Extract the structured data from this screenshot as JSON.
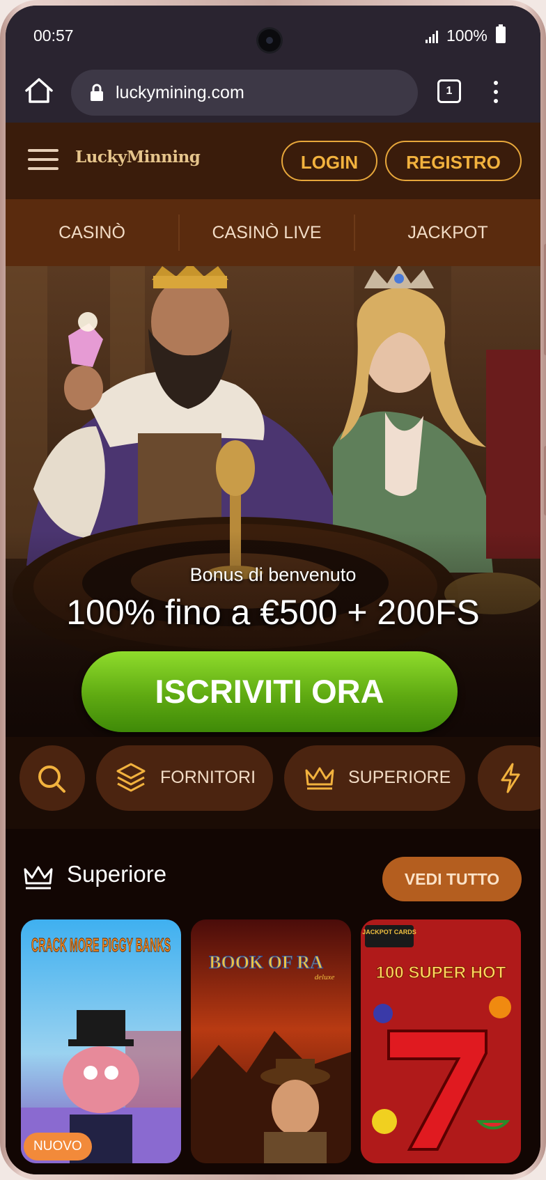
{
  "status_bar": {
    "time": "00:57",
    "battery": "100%"
  },
  "browser": {
    "url": "luckymining.com",
    "tab_count": "1"
  },
  "header": {
    "logo": "LuckyMinning",
    "login_label": "LOGIN",
    "register_label": "REGISTRO"
  },
  "nav": {
    "items": [
      {
        "label": "CASINÒ"
      },
      {
        "label": "CASINÒ LIVE"
      },
      {
        "label": "JACKPOT"
      }
    ]
  },
  "hero": {
    "subtitle": "Bonus di benvenuto",
    "title": "100% fino a €500 + 200FS",
    "cta_label": "ISCRIVITI ORA"
  },
  "filters": {
    "items": [
      {
        "icon": "search-icon"
      },
      {
        "icon": "layers-icon",
        "label": "FORNITORI"
      },
      {
        "icon": "crown-icon",
        "label": "SUPERIORE"
      },
      {
        "icon": "lightning-icon"
      }
    ]
  },
  "section": {
    "icon": "crown-icon",
    "title": "Superiore",
    "view_all_label": "VEDI TUTTO",
    "games": [
      {
        "logo": "CRACK MORE PIGGY BANKS",
        "badge": "NUOVO"
      },
      {
        "logo": "BOOK OF RA",
        "logo_sub": "deluxe"
      },
      {
        "logo": "100 SUPER HOT",
        "brand": "JACKPOT CARDS"
      }
    ]
  },
  "colors": {
    "accent": "#f2b23e",
    "header_bg": "#3a1c0b",
    "nav_bg": "#5a2b0e",
    "cta_green": "#6cbf16",
    "chip_bg": "#4b2410",
    "view_all_bg": "#b45e1f"
  }
}
